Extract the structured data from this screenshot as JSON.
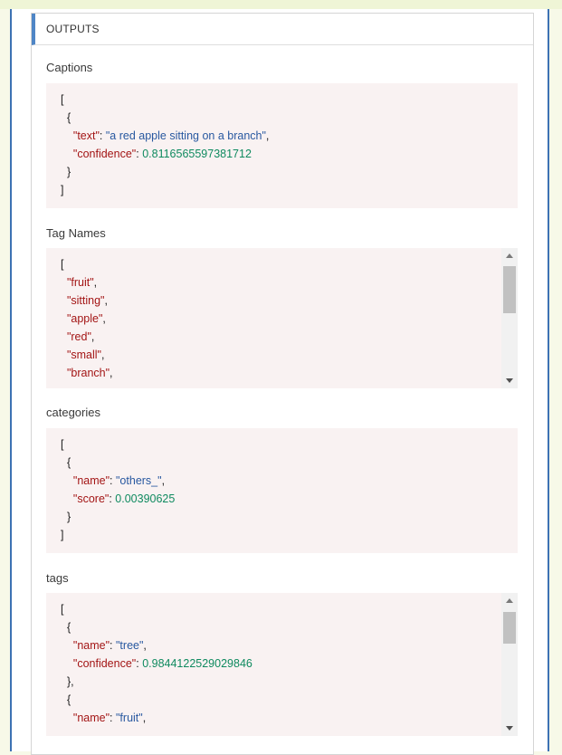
{
  "outputs": {
    "header": "OUTPUTS",
    "sections": [
      {
        "label": "Captions",
        "lines": [
          [
            {
              "t": "p",
              "v": "["
            }
          ],
          [
            {
              "t": "p",
              "v": "  {"
            }
          ],
          [
            {
              "t": "k",
              "v": "    \"text\""
            },
            {
              "t": "p",
              "v": ": "
            },
            {
              "t": "s",
              "v": "\"a red apple sitting on a branch\""
            },
            {
              "t": "p",
              "v": ","
            }
          ],
          [
            {
              "t": "k",
              "v": "    \"confidence\""
            },
            {
              "t": "p",
              "v": ": "
            },
            {
              "t": "n",
              "v": "0.8116565597381712"
            }
          ],
          [
            {
              "t": "p",
              "v": "  }"
            }
          ],
          [
            {
              "t": "p",
              "v": "]"
            }
          ]
        ]
      },
      {
        "label": "Tag Names",
        "lines": [
          [
            {
              "t": "p",
              "v": "["
            }
          ],
          [
            {
              "t": "k",
              "v": "  \"fruit\""
            },
            {
              "t": "p",
              "v": ","
            }
          ],
          [
            {
              "t": "k",
              "v": "  \"sitting\""
            },
            {
              "t": "p",
              "v": ","
            }
          ],
          [
            {
              "t": "k",
              "v": "  \"apple\""
            },
            {
              "t": "p",
              "v": ","
            }
          ],
          [
            {
              "t": "k",
              "v": "  \"red\""
            },
            {
              "t": "p",
              "v": ","
            }
          ],
          [
            {
              "t": "k",
              "v": "  \"small\""
            },
            {
              "t": "p",
              "v": ","
            }
          ],
          [
            {
              "t": "k",
              "v": "  \"branch\""
            },
            {
              "t": "p",
              "v": ","
            }
          ]
        ]
      },
      {
        "label": "categories",
        "lines": [
          [
            {
              "t": "p",
              "v": "["
            }
          ],
          [
            {
              "t": "p",
              "v": "  {"
            }
          ],
          [
            {
              "t": "k",
              "v": "    \"name\""
            },
            {
              "t": "p",
              "v": ": "
            },
            {
              "t": "s",
              "v": "\"others_\""
            },
            {
              "t": "p",
              "v": ","
            }
          ],
          [
            {
              "t": "k",
              "v": "    \"score\""
            },
            {
              "t": "p",
              "v": ": "
            },
            {
              "t": "n",
              "v": "0.00390625"
            }
          ],
          [
            {
              "t": "p",
              "v": "  }"
            }
          ],
          [
            {
              "t": "p",
              "v": "]"
            }
          ]
        ]
      },
      {
        "label": "tags",
        "lines": [
          [
            {
              "t": "p",
              "v": "["
            }
          ],
          [
            {
              "t": "p",
              "v": "  {"
            }
          ],
          [
            {
              "t": "k",
              "v": "    \"name\""
            },
            {
              "t": "p",
              "v": ": "
            },
            {
              "t": "s",
              "v": "\"tree\""
            },
            {
              "t": "p",
              "v": ","
            }
          ],
          [
            {
              "t": "k",
              "v": "    \"confidence\""
            },
            {
              "t": "p",
              "v": ": "
            },
            {
              "t": "n",
              "v": "0.9844122529029846"
            }
          ],
          [
            {
              "t": "p",
              "v": "  },"
            }
          ],
          [
            {
              "t": "p",
              "v": "  {"
            }
          ],
          [
            {
              "t": "k",
              "v": "    \"name\""
            },
            {
              "t": "p",
              "v": ": "
            },
            {
              "t": "s",
              "v": "\"fruit\""
            },
            {
              "t": "p",
              "v": ","
            }
          ]
        ]
      }
    ]
  }
}
